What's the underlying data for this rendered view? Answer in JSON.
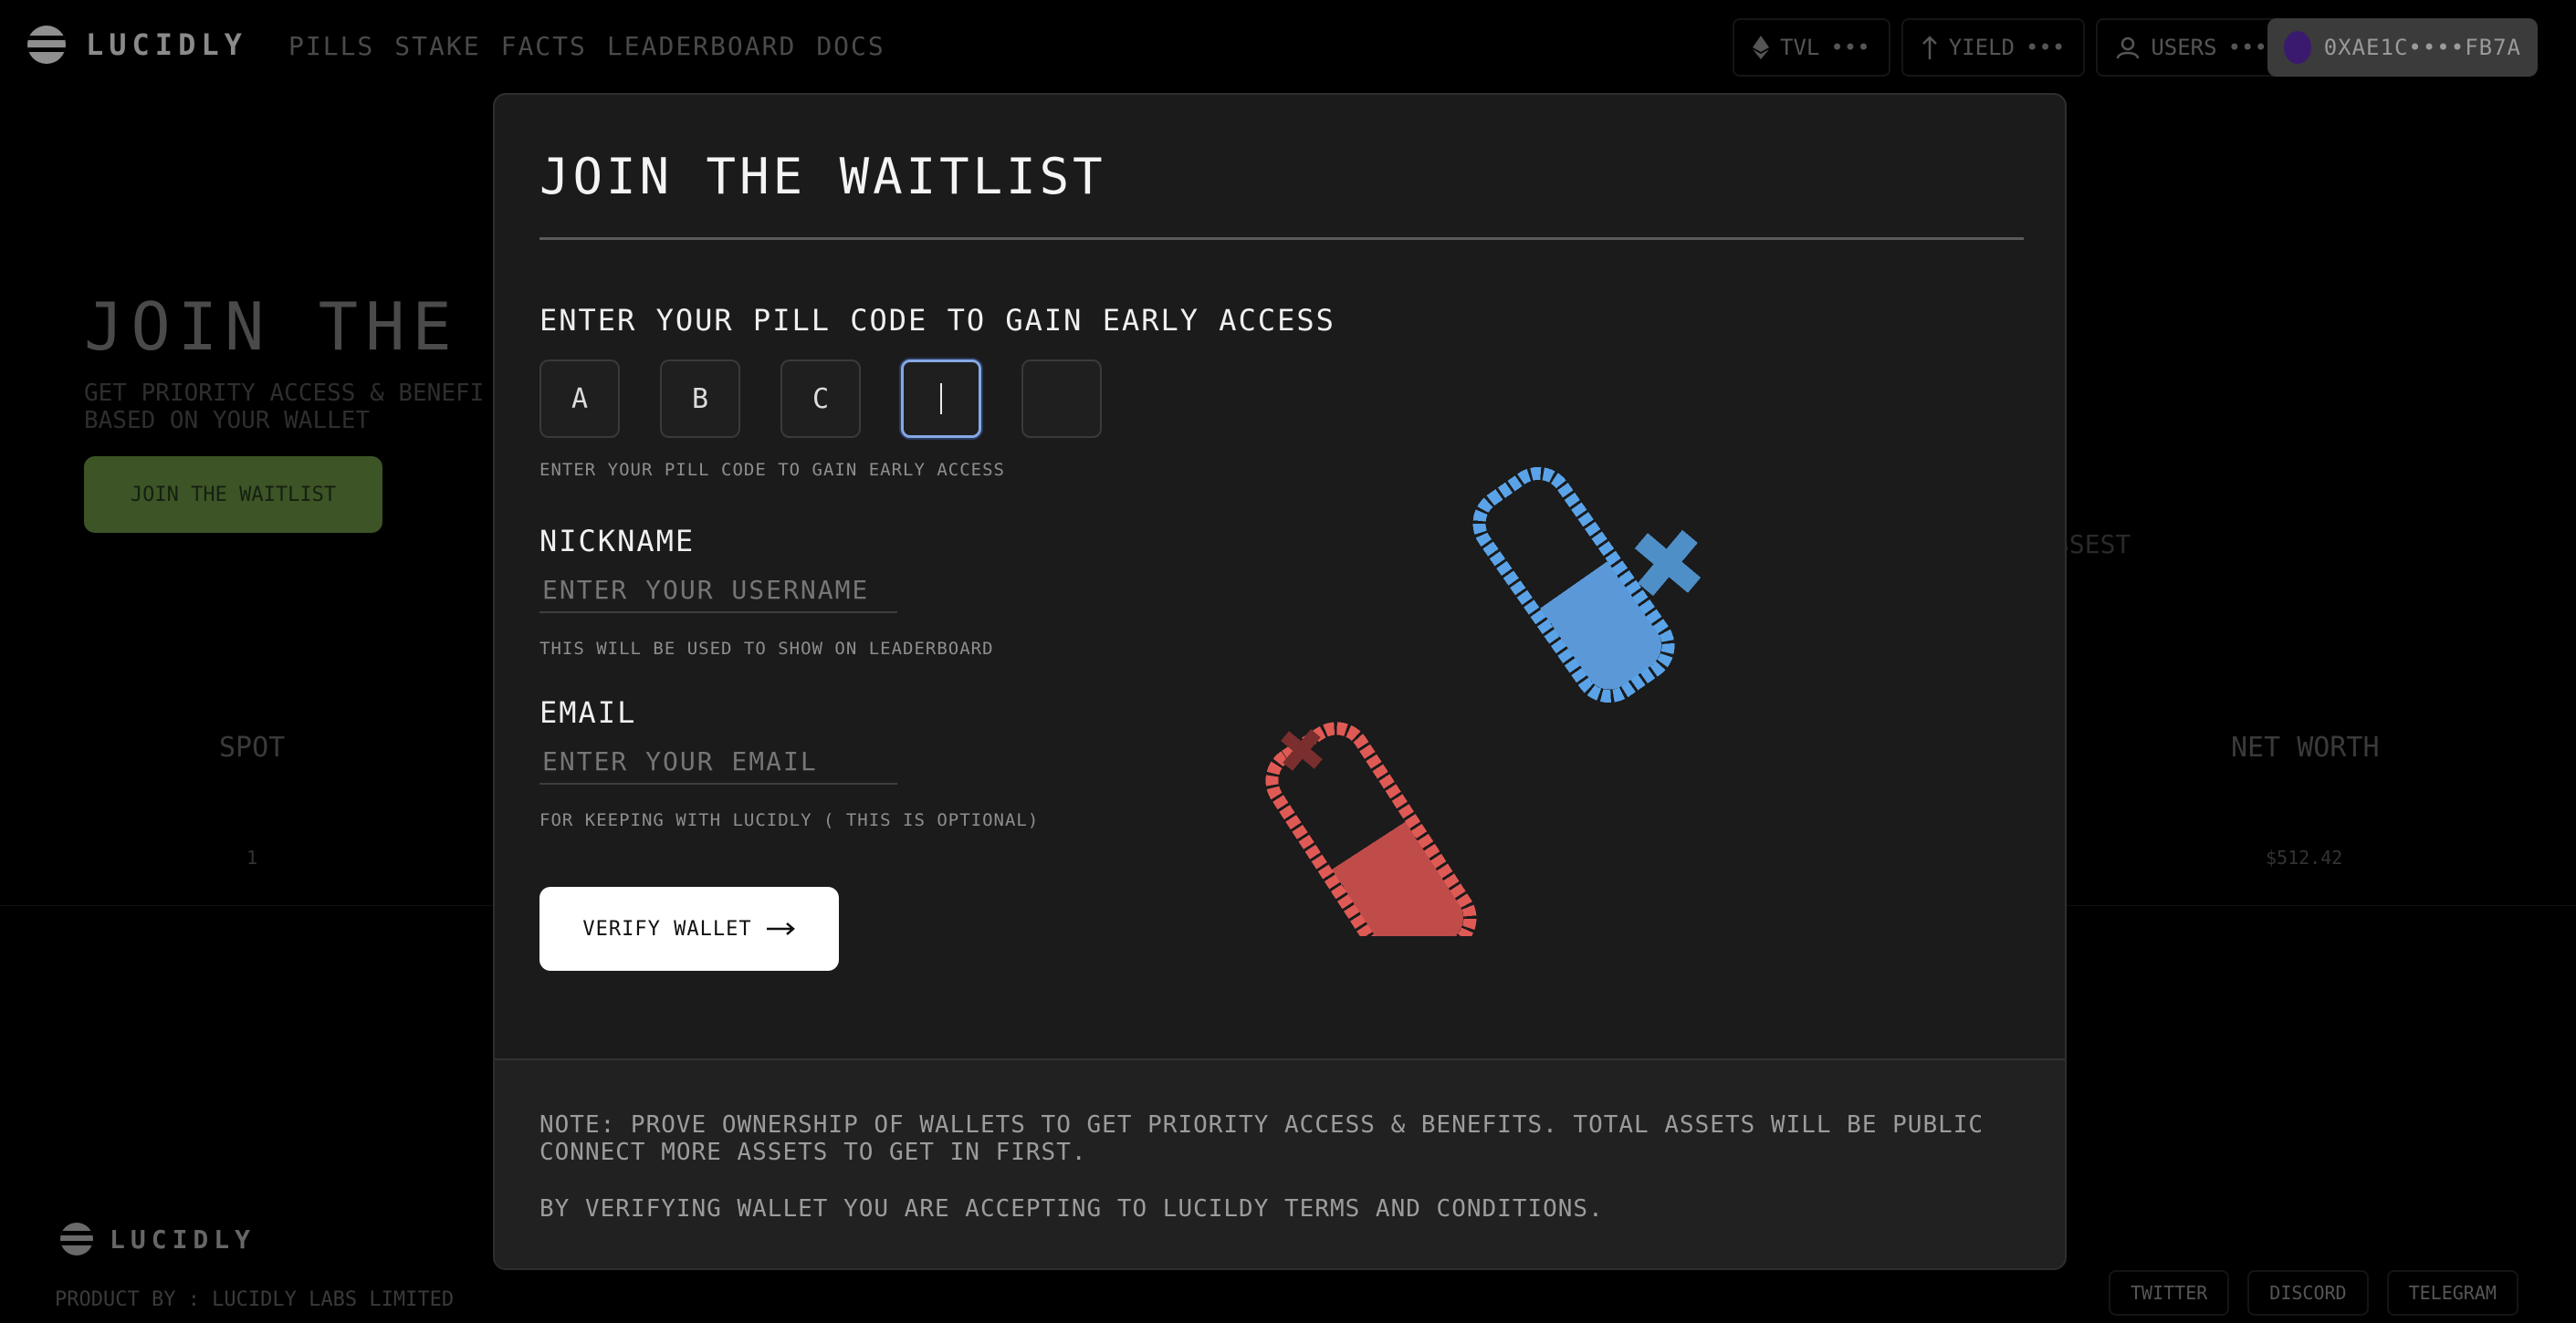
{
  "navbar": {
    "logo_text": "LUCIDLY",
    "links": [
      "PILLS",
      "STAKE",
      "FACTS",
      "LEADERBOARD",
      "DOCS"
    ],
    "stats": [
      {
        "icon": "ethereum-icon",
        "label": "TVL",
        "value": "•••"
      },
      {
        "icon": "arrow-up-icon",
        "label": "YIELD",
        "value": "•••"
      },
      {
        "icon": "user-icon",
        "label": "USERS",
        "value": "•••"
      }
    ],
    "wallet_address": "0XAE1C••••FB7A"
  },
  "background": {
    "hero_title": "JOIN THE WA",
    "hero_subtitle": "GET PRIORITY ACCESS & BENEFI BASED ON YOUR WALLET",
    "hero_button": "JOIN THE WAITLIST",
    "assets_label": "SSEST",
    "table": {
      "col_spot": "SPOT",
      "col_net_worth": "NET WORTH",
      "row_spot": "1",
      "row_net_worth": "$512.42"
    },
    "footer": {
      "logo_text": "LUCIDLY",
      "product_by": "PRODUCT BY : LUCIDLY LABS LIMITED",
      "links": [
        "TWITTER",
        "DISCORD",
        "TELEGRAM"
      ]
    }
  },
  "modal": {
    "title": "JOIN THE WAITLIST",
    "code_label": "ENTER YOUR PILL CODE TO GAIN EARLY ACCESS",
    "code_chars": [
      "A",
      "B",
      "C",
      "",
      ""
    ],
    "code_help": "ENTER YOUR PILL CODE TO GAIN EARLY ACCESS",
    "nickname": {
      "label": "NICKNAME",
      "placeholder": "ENTER YOUR USERNAME",
      "value": "",
      "help": "THIS WILL BE USED TO SHOW ON LEADERBOARD"
    },
    "email": {
      "label": "EMAIL",
      "placeholder": "ENTER YOUR EMAIL",
      "value": "",
      "help": "FOR KEEPING WITH LUCIDLY ( THIS IS OPTIONAL)"
    },
    "verify_button": "VERIFY WALLET",
    "note": "NOTE: PROVE OWNERSHIP OF WALLETS TO GET PRIORITY ACCESS & BENEFITS. TOTAL ASSETS WILL BE PUBLIC CONNECT MORE ASSETS TO GET IN FIRST.",
    "terms": "BY VERIFYING WALLET YOU ARE ACCEPTING TO LUCILDY TERMS AND CONDITIONS."
  },
  "colors": {
    "blue_pill": "#5aa3e8",
    "red_pill": "#e05a55",
    "hero_button": "#3d5426",
    "input_focus": "#86a8e6"
  }
}
